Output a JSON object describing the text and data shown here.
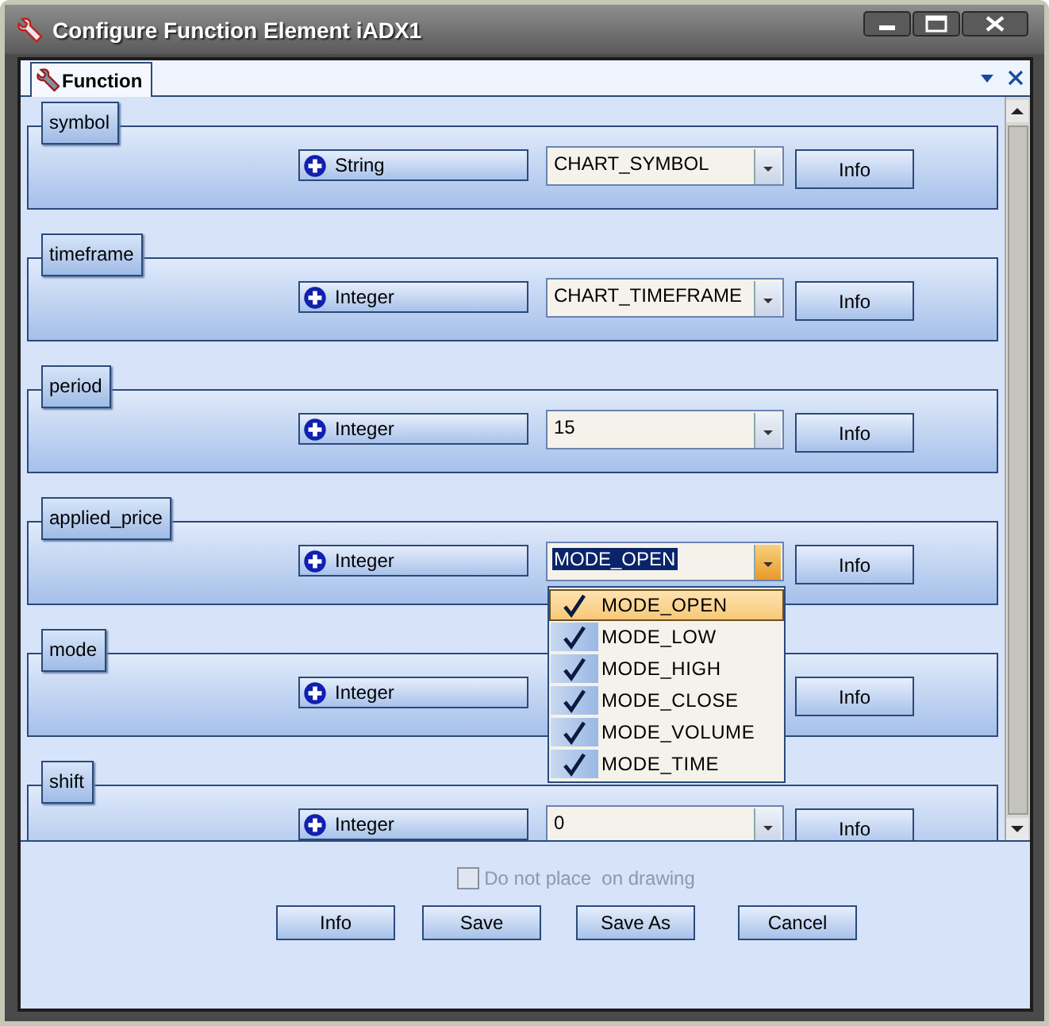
{
  "window": {
    "title": "Configure Function Element iADX1"
  },
  "tabs": [
    {
      "label": "Function",
      "selected": true
    }
  ],
  "parameters": [
    {
      "name": "symbol",
      "type": "String",
      "value": "CHART_SYMBOL",
      "focused": false,
      "info": "Info"
    },
    {
      "name": "timeframe",
      "type": "Integer",
      "value": "CHART_TIMEFRAME",
      "focused": false,
      "info": "Info"
    },
    {
      "name": "period",
      "type": "Integer",
      "value": "15",
      "focused": false,
      "info": "Info"
    },
    {
      "name": "applied_price",
      "type": "Integer",
      "value": "MODE_OPEN",
      "focused": true,
      "info": "Info",
      "open_list": [
        {
          "label": "MODE_OPEN",
          "checked": true,
          "selected": true
        },
        {
          "label": "MODE_LOW",
          "checked": true,
          "selected": false
        },
        {
          "label": "MODE_HIGH",
          "checked": true,
          "selected": false
        },
        {
          "label": "MODE_CLOSE",
          "checked": true,
          "selected": false
        },
        {
          "label": "MODE_VOLUME",
          "checked": true,
          "selected": false
        },
        {
          "label": "MODE_TIME",
          "checked": true,
          "selected": false
        }
      ]
    },
    {
      "name": "mode",
      "type": "Integer",
      "info": "Info"
    },
    {
      "name": "shift",
      "type": "Integer",
      "value": "0",
      "focused": false,
      "info": "Info"
    }
  ],
  "checkbox": {
    "label": "Do not place  on drawing",
    "checked": false,
    "disabled": true
  },
  "buttons": [
    "Info",
    "Save",
    "Save As",
    "Cancel"
  ]
}
